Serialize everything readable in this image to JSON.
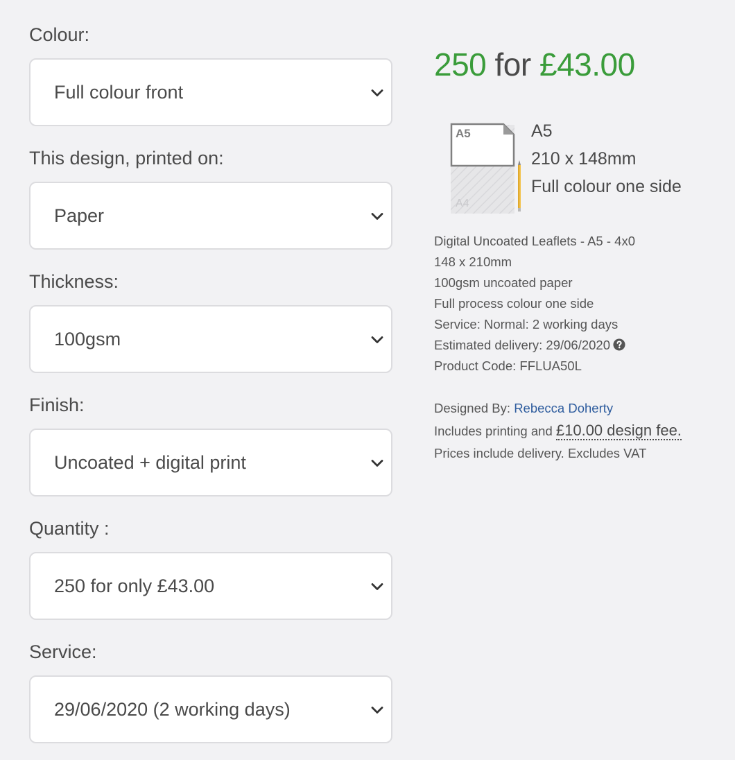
{
  "options": [
    {
      "label": "Colour:",
      "value": "Full colour front"
    },
    {
      "label": "This design, printed on:",
      "value": "Paper"
    },
    {
      "label": "Thickness:",
      "value": "100gsm"
    },
    {
      "label": "Finish:",
      "value": "Uncoated + digital print"
    },
    {
      "label": "Quantity :",
      "value": "250 for only £43.00"
    },
    {
      "label": "Service:",
      "value": "29/06/2020 (2 working days)"
    }
  ],
  "summary": {
    "quantity": "250",
    "for_word": " for ",
    "price": "£43.00",
    "accent_color": "#3a9c3a",
    "size_graphic": {
      "inner_label": "A5",
      "outer_label": "A4"
    },
    "size_lines": [
      "A5",
      "210 x 148mm",
      "Full colour one side"
    ],
    "specs": [
      "Digital Uncoated Leaflets - A5 - 4x0",
      "148 x 210mm",
      "100gsm uncoated paper",
      "Full process colour one side",
      "Service: Normal: 2 working days",
      "Estimated delivery: 29/06/2020",
      "Product Code: FFLUA50L"
    ],
    "designed_by_label": "Designed By:",
    "designer_name": "Rebecca Doherty",
    "includes_text": "Includes printing and",
    "design_fee": "£10.00 design fee.",
    "prices_note": "Prices include delivery. Excludes VAT"
  },
  "icons": {
    "chevron": "chevron-down-icon",
    "help": "question-circle-icon"
  }
}
